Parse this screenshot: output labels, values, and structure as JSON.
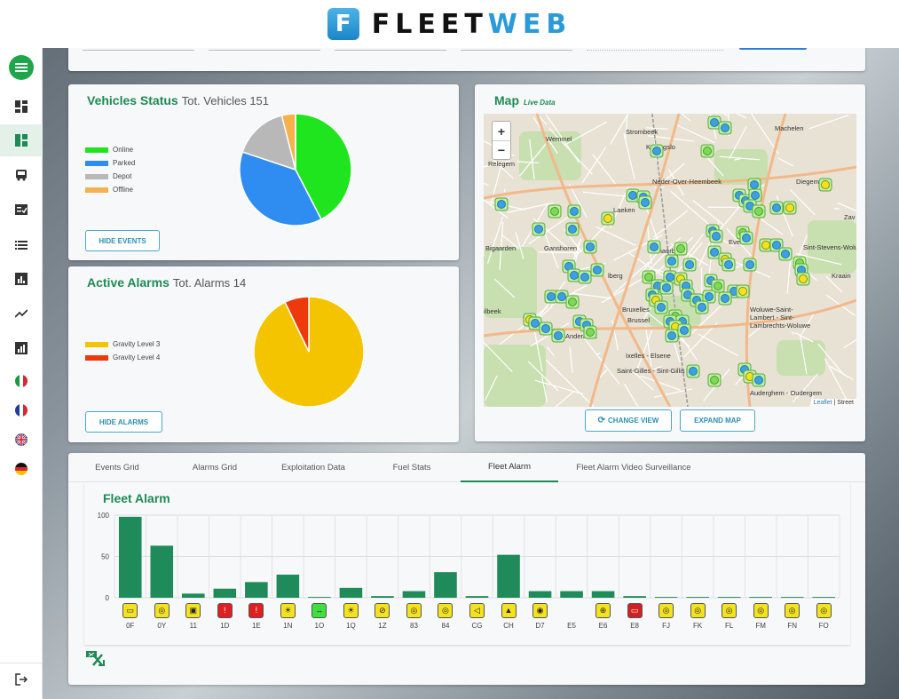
{
  "app": {
    "logo_mark": "F",
    "logo_text_a": "FLEET",
    "logo_text_b": "WEB"
  },
  "sidebar": {
    "items": [
      {
        "icon": "menu-icon",
        "active": false
      },
      {
        "icon": "dashboard-icon",
        "active": false
      },
      {
        "icon": "dashboard-alt-icon",
        "active": true
      },
      {
        "icon": "bus-icon",
        "active": false
      },
      {
        "icon": "checklist-icon",
        "active": false
      },
      {
        "icon": "list-icon",
        "active": false
      },
      {
        "icon": "report-icon",
        "active": false
      },
      {
        "icon": "trend-icon",
        "active": false
      },
      {
        "icon": "bar-report-icon",
        "active": false
      },
      {
        "icon": "flag-italy-icon",
        "active": false
      },
      {
        "icon": "flag-france-icon",
        "active": false
      },
      {
        "icon": "flag-uk-icon",
        "active": false
      },
      {
        "icon": "flag-germany-icon",
        "active": false
      },
      {
        "icon": "logout-icon",
        "active": false
      }
    ]
  },
  "vehicles_status": {
    "title": "Vehicles Status",
    "subtitle": "Tot. Vehicles 151",
    "button": "HIDE EVENTS",
    "legend": [
      {
        "label": "Online",
        "color": "#1ee51e"
      },
      {
        "label": "Parked",
        "color": "#2f8cf0"
      },
      {
        "label": "Depot",
        "color": "#b8b8b8"
      },
      {
        "label": "Offline",
        "color": "#f5b14c"
      }
    ],
    "slices": [
      {
        "label": "Online",
        "value": 64,
        "color": "#1ee51e"
      },
      {
        "label": "Parked",
        "value": 57,
        "color": "#2f8cf0"
      },
      {
        "label": "Depot",
        "value": 24,
        "color": "#b8b8b8"
      },
      {
        "label": "Offline",
        "value": 6,
        "color": "#f5b14c"
      }
    ]
  },
  "active_alarms": {
    "title": "Active Alarms",
    "subtitle": "Tot. Alarms 14",
    "button": "HIDE ALARMS",
    "legend": [
      {
        "label": "Gravity Level 3",
        "color": "#f4c400"
      },
      {
        "label": "Gravity Level 4",
        "color": "#ec3a0c"
      }
    ],
    "slices": [
      {
        "label": "Gravity Level 3",
        "value": 13,
        "color": "#f4c400"
      },
      {
        "label": "Gravity Level 4",
        "value": 1,
        "color": "#ec3a0c"
      }
    ]
  },
  "map": {
    "title": "Map",
    "subtitle": "Live Data",
    "zoom_in": "+",
    "zoom_out": "−",
    "change_view": "CHANGE VIEW",
    "expand_map": "EXPAND MAP",
    "attribution_link": "Leaflet",
    "attribution_rest": "| Street",
    "places": [
      {
        "name": "Wemmel"
      },
      {
        "name": "Strombeek"
      },
      {
        "name": "Machelen"
      },
      {
        "name": "Relegem"
      },
      {
        "name": "Koningslo"
      },
      {
        "name": "Neder-Over-Heembeek"
      },
      {
        "name": "Diegem"
      },
      {
        "name": "Laeken"
      },
      {
        "name": "Zav"
      },
      {
        "name": "Bigaarden"
      },
      {
        "name": "Ganshoren"
      },
      {
        "name": "Schaerbeek"
      },
      {
        "name": "Evere"
      },
      {
        "name": "Sint-Stevens-Woluwe"
      },
      {
        "name": "Kraain"
      },
      {
        "name": "lberg"
      },
      {
        "name": "Bruxelles"
      },
      {
        "name": "Brussel"
      },
      {
        "name": "Woluwe-Saint-Lambert - Sint-Lambrechts-Woluwe"
      },
      {
        "name": "ilbeek"
      },
      {
        "name": "Anderlecht"
      },
      {
        "name": "Ixelles - Elsene"
      },
      {
        "name": "Saint-Gilles - Sint-Gillis"
      },
      {
        "name": "Auderghem - Oudergem"
      }
    ]
  },
  "tabs": [
    {
      "label": "Events Grid",
      "active": false
    },
    {
      "label": "Alarms Grid",
      "active": false
    },
    {
      "label": "Exploitation Data",
      "active": false
    },
    {
      "label": "Fuel Stats",
      "active": false
    },
    {
      "label": "Fleet Alarm",
      "active": true
    },
    {
      "label": "Fleet Alarm Video Surveillance",
      "active": false
    }
  ],
  "chart_data": {
    "type": "bar",
    "title": "Fleet Alarm",
    "xlabel": "",
    "ylabel": "",
    "ylim": [
      0,
      100
    ],
    "yticks": [
      0,
      50,
      100
    ],
    "grid": true,
    "categories": [
      "0F",
      "0Y",
      "11",
      "1D",
      "1E",
      "1N",
      "1O",
      "1Q",
      "1Z",
      "83",
      "84",
      "CG",
      "CH",
      "D7",
      "E5",
      "E6",
      "E8",
      "FJ",
      "FK",
      "FL",
      "FM",
      "FN",
      "FO"
    ],
    "values": [
      98,
      63,
      5,
      11,
      19,
      28,
      1,
      12,
      2,
      8,
      31,
      2,
      52,
      8,
      8,
      8,
      2,
      1,
      1,
      1,
      1,
      1,
      1
    ],
    "bar_color": "#1f8a5a",
    "category_icons": [
      {
        "glyph": "▭",
        "bg": "#f4e21e",
        "fg": "#222"
      },
      {
        "glyph": "◎",
        "bg": "#f4e21e",
        "fg": "#222"
      },
      {
        "glyph": "▣",
        "bg": "#f4e21e",
        "fg": "#222"
      },
      {
        "glyph": "!",
        "bg": "#e02020",
        "fg": "#fff"
      },
      {
        "glyph": "!",
        "bg": "#e02020",
        "fg": "#fff"
      },
      {
        "glyph": "☀",
        "bg": "#f4e21e",
        "fg": "#222"
      },
      {
        "glyph": "↔",
        "bg": "#3ee03e",
        "fg": "#222"
      },
      {
        "glyph": "☀",
        "bg": "#f4e21e",
        "fg": "#222"
      },
      {
        "glyph": "⊘",
        "bg": "#f4e21e",
        "fg": "#222"
      },
      {
        "glyph": "◎",
        "bg": "#f4e21e",
        "fg": "#222"
      },
      {
        "glyph": "◎",
        "bg": "#f4e21e",
        "fg": "#222"
      },
      {
        "glyph": "◁",
        "bg": "#f4e21e",
        "fg": "#222"
      },
      {
        "glyph": "▲",
        "bg": "#f4e21e",
        "fg": "#222"
      },
      {
        "glyph": "◉",
        "bg": "#f4e21e",
        "fg": "#222"
      },
      {
        "glyph": "",
        "bg": "none",
        "fg": "#222"
      },
      {
        "glyph": "⊕",
        "bg": "#f4e21e",
        "fg": "#222"
      },
      {
        "glyph": "▭",
        "bg": "#d02020",
        "fg": "#fff"
      },
      {
        "glyph": "◎",
        "bg": "#f4e21e",
        "fg": "#222"
      },
      {
        "glyph": "◎",
        "bg": "#f4e21e",
        "fg": "#222"
      },
      {
        "glyph": "◎",
        "bg": "#f4e21e",
        "fg": "#222"
      },
      {
        "glyph": "◎",
        "bg": "#f4e21e",
        "fg": "#222"
      },
      {
        "glyph": "◎",
        "bg": "#f4e21e",
        "fg": "#222"
      },
      {
        "glyph": "◎",
        "bg": "#f4e21e",
        "fg": "#222"
      }
    ]
  },
  "export_icon": "export-excel-icon"
}
